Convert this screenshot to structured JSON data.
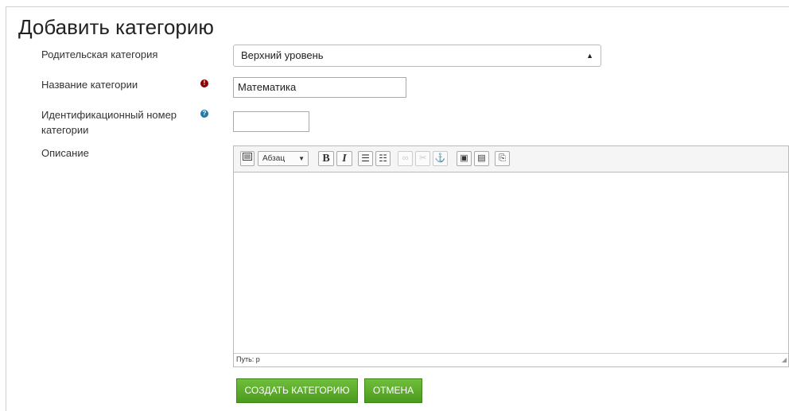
{
  "page_title": "Добавить категорию",
  "form": {
    "parent_label": "Родительская категория",
    "parent_value": "Верхний уровень",
    "name_label": "Название категории",
    "name_value": "Математика",
    "idnumber_label_line1": "Идентификационный номер",
    "idnumber_label_line2": "категории",
    "idnumber_value": "",
    "description_label": "Описание"
  },
  "editor": {
    "format_value": "Абзац",
    "bold": "B",
    "italic": "I",
    "path_text": "Путь: p"
  },
  "buttons": {
    "create": "СОЗДАТЬ КАТЕГОРИЮ",
    "cancel": "ОТМЕНА"
  },
  "icons": {
    "required": "exclamation-circle-icon",
    "help": "question-circle-icon"
  },
  "colors": {
    "button_green": "#5aa82a",
    "required_red": "#8b0000",
    "help_blue": "#1f7aa8"
  }
}
